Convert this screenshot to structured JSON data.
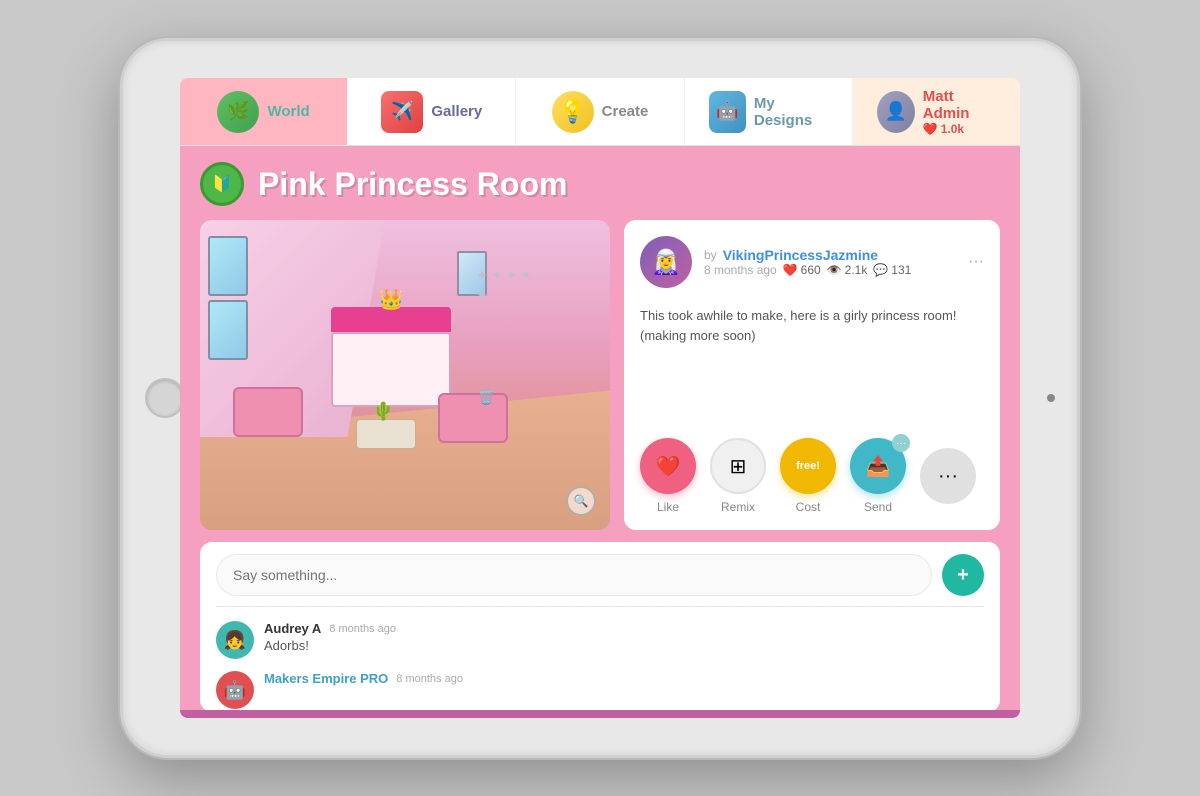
{
  "nav": {
    "items": [
      {
        "id": "world",
        "label": "World",
        "icon": "🌿",
        "active": true
      },
      {
        "id": "gallery",
        "label": "Gallery",
        "icon": "✈️",
        "active": false
      },
      {
        "id": "create",
        "label": "Create",
        "icon": "💡",
        "active": false
      },
      {
        "id": "mydesigns",
        "label": "My Designs",
        "icon": "🤖",
        "active": false
      }
    ],
    "user": {
      "name": "Matt Admin",
      "hearts": "❤️1.0k",
      "hearts_count": "1.0k"
    }
  },
  "page": {
    "title": "Pink Princess Room",
    "badge_icon": "🔰"
  },
  "design": {
    "author_name": "VikingPrincessJazmine",
    "time_ago": "8 months ago",
    "likes": "660",
    "views": "2.1k",
    "comments_count": "131",
    "description": "This took awhile to make, here is a girly princess room! (making more soon)"
  },
  "actions": {
    "like_label": "Like",
    "remix_label": "Remix",
    "cost_label": "Cost",
    "cost_value": "free!",
    "send_label": "Send",
    "more_label": "..."
  },
  "comments": {
    "input_placeholder": "Say something...",
    "items": [
      {
        "author": "Audrey A",
        "time": "8 months ago",
        "text": "Adorbs!",
        "avatar_color": "teal"
      },
      {
        "author": "Makers Empire PRO",
        "time": "8 months ago",
        "text": "",
        "avatar_color": "red"
      }
    ]
  },
  "colors": {
    "bg_pink": "#f5a0c0",
    "nav_white": "#ffffff",
    "teal_btn": "#20b8a0",
    "user_bg": "#ffeedd",
    "active_nav": "#ffb6c1"
  }
}
